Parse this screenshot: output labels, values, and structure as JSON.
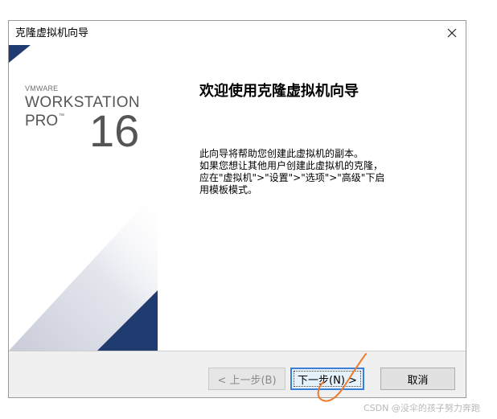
{
  "window": {
    "title": "克隆虚拟机向导",
    "close_icon": "close-icon"
  },
  "brand": {
    "company": "VMWARE",
    "product": "WORKSTATION",
    "edition": "PRO",
    "trademark": "™",
    "version": "16"
  },
  "content": {
    "heading": "欢迎使用克隆虚拟机向导",
    "lines": [
      "此向导将帮助您创建此虚拟机的副本。",
      "如果您想让其他用户创建此虚拟机的克隆，",
      "应在\"虚拟机\">\"设置\">\"选项\">\"高级\"下启",
      "用模板模式。"
    ]
  },
  "buttons": {
    "back": "< 上一步(B)",
    "next": "下一步(N) >",
    "cancel": "取消"
  },
  "colors": {
    "accent_navy": "#1f3b6f",
    "annotation_orange": "#f07a2c"
  },
  "watermark": "CSDN @没伞的孩子努力奔跑"
}
